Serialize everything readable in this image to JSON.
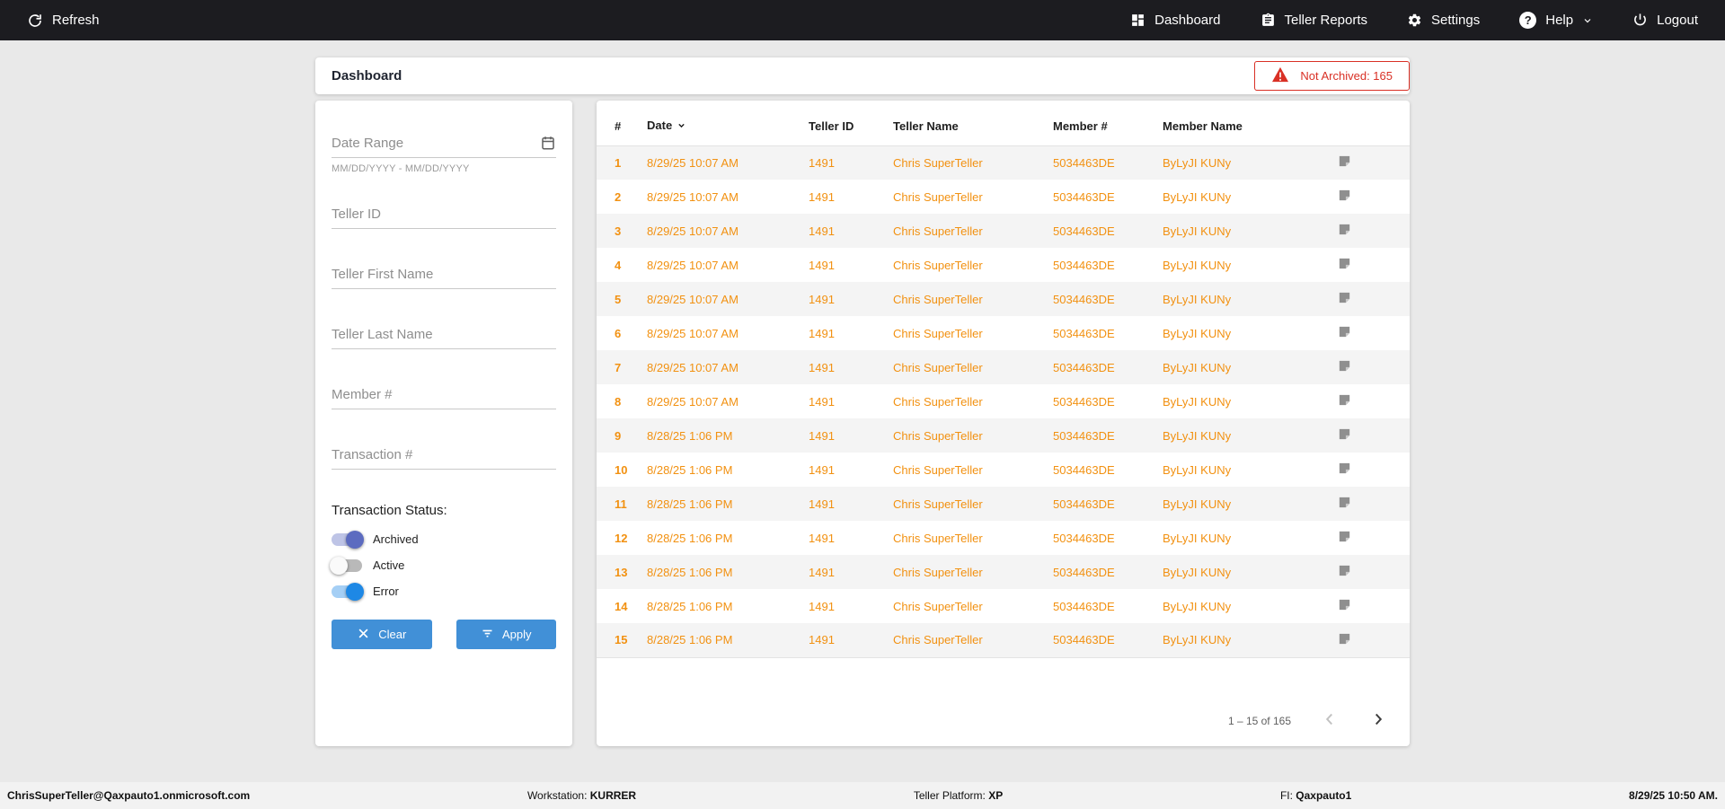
{
  "topbar": {
    "refresh_label": "Refresh",
    "items": [
      {
        "label": "Dashboard"
      },
      {
        "label": "Teller Reports"
      },
      {
        "label": "Settings"
      },
      {
        "label": "Help"
      },
      {
        "label": "Logout"
      }
    ],
    "background_color": "#1c1c20"
  },
  "header": {
    "title": "Dashboard",
    "badge_text": "Not Archived: 165",
    "badge_color": "#d93025"
  },
  "filters": {
    "date_range": {
      "placeholder": "Date Range",
      "value": "",
      "hint": "MM/DD/YYYY - MM/DD/YYYY"
    },
    "teller_id": {
      "placeholder": "Teller ID",
      "value": ""
    },
    "teller_first_name": {
      "placeholder": "Teller First Name",
      "value": ""
    },
    "teller_last_name": {
      "placeholder": "Teller Last Name",
      "value": ""
    },
    "member_number": {
      "placeholder": "Member #",
      "value": ""
    },
    "transaction_number": {
      "placeholder": "Transaction #",
      "value": ""
    },
    "status_label": "Transaction Status:",
    "toggles": [
      {
        "label": "Archived",
        "on": true,
        "color": "#5c6bc0"
      },
      {
        "label": "Active",
        "on": false,
        "color": "#9e9e9e"
      },
      {
        "label": "Error",
        "on": true,
        "color": "#1e88e5"
      }
    ],
    "clear_label": "Clear",
    "apply_label": "Apply",
    "button_color": "#4190d7"
  },
  "table": {
    "columns": [
      "#",
      "Date",
      "Teller ID",
      "Teller Name",
      "Member #",
      "Member Name"
    ],
    "sorted_column": "Date",
    "sort_direction": "desc",
    "row_text_color": "#f29111",
    "rows": [
      {
        "num": "1",
        "date": "8/29/25 10:07 AM",
        "teller_id": "1491",
        "teller_name": "Chris SuperTeller",
        "member_num": "5034463DE",
        "member_name": "ByLyJI KUNy"
      },
      {
        "num": "2",
        "date": "8/29/25 10:07 AM",
        "teller_id": "1491",
        "teller_name": "Chris SuperTeller",
        "member_num": "5034463DE",
        "member_name": "ByLyJI KUNy"
      },
      {
        "num": "3",
        "date": "8/29/25 10:07 AM",
        "teller_id": "1491",
        "teller_name": "Chris SuperTeller",
        "member_num": "5034463DE",
        "member_name": "ByLyJI KUNy"
      },
      {
        "num": "4",
        "date": "8/29/25 10:07 AM",
        "teller_id": "1491",
        "teller_name": "Chris SuperTeller",
        "member_num": "5034463DE",
        "member_name": "ByLyJI KUNy"
      },
      {
        "num": "5",
        "date": "8/29/25 10:07 AM",
        "teller_id": "1491",
        "teller_name": "Chris SuperTeller",
        "member_num": "5034463DE",
        "member_name": "ByLyJI KUNy"
      },
      {
        "num": "6",
        "date": "8/29/25 10:07 AM",
        "teller_id": "1491",
        "teller_name": "Chris SuperTeller",
        "member_num": "5034463DE",
        "member_name": "ByLyJI KUNy"
      },
      {
        "num": "7",
        "date": "8/29/25 10:07 AM",
        "teller_id": "1491",
        "teller_name": "Chris SuperTeller",
        "member_num": "5034463DE",
        "member_name": "ByLyJI KUNy"
      },
      {
        "num": "8",
        "date": "8/29/25 10:07 AM",
        "teller_id": "1491",
        "teller_name": "Chris SuperTeller",
        "member_num": "5034463DE",
        "member_name": "ByLyJI KUNy"
      },
      {
        "num": "9",
        "date": "8/28/25 1:06 PM",
        "teller_id": "1491",
        "teller_name": "Chris SuperTeller",
        "member_num": "5034463DE",
        "member_name": "ByLyJI KUNy"
      },
      {
        "num": "10",
        "date": "8/28/25 1:06 PM",
        "teller_id": "1491",
        "teller_name": "Chris SuperTeller",
        "member_num": "5034463DE",
        "member_name": "ByLyJI KUNy"
      },
      {
        "num": "11",
        "date": "8/28/25 1:06 PM",
        "teller_id": "1491",
        "teller_name": "Chris SuperTeller",
        "member_num": "5034463DE",
        "member_name": "ByLyJI KUNy"
      },
      {
        "num": "12",
        "date": "8/28/25 1:06 PM",
        "teller_id": "1491",
        "teller_name": "Chris SuperTeller",
        "member_num": "5034463DE",
        "member_name": "ByLyJI KUNy"
      },
      {
        "num": "13",
        "date": "8/28/25 1:06 PM",
        "teller_id": "1491",
        "teller_name": "Chris SuperTeller",
        "member_num": "5034463DE",
        "member_name": "ByLyJI KUNy"
      },
      {
        "num": "14",
        "date": "8/28/25 1:06 PM",
        "teller_id": "1491",
        "teller_name": "Chris SuperTeller",
        "member_num": "5034463DE",
        "member_name": "ByLyJI KUNy"
      },
      {
        "num": "15",
        "date": "8/28/25 1:06 PM",
        "teller_id": "1491",
        "teller_name": "Chris SuperTeller",
        "member_num": "5034463DE",
        "member_name": "ByLyJI KUNy"
      }
    ],
    "pagination": {
      "range_label": "1 – 15 of 165"
    }
  },
  "footer": {
    "user": "ChrisSuperTeller@Qaxpauto1.onmicrosoft.com",
    "workstation_label": "Workstation:",
    "workstation_value": "KURRER",
    "platform_label": "Teller Platform:",
    "platform_value": "XP",
    "fi_label": "FI:",
    "fi_value": "Qaxpauto1",
    "timestamp": "8/29/25 10:50 AM."
  }
}
